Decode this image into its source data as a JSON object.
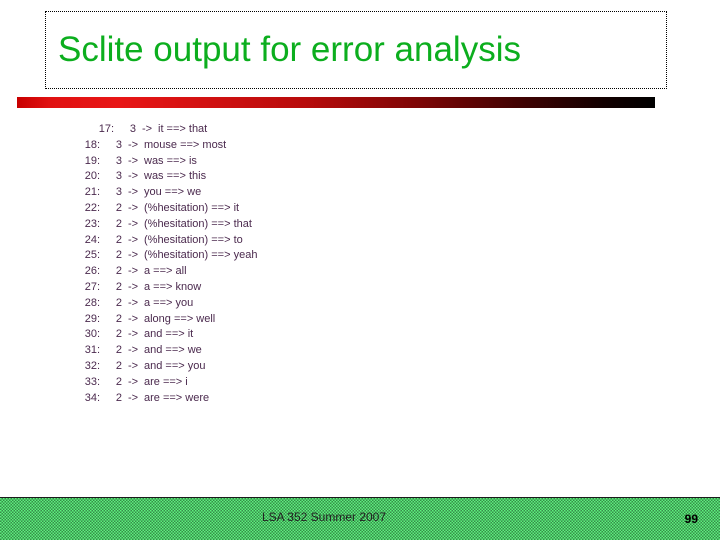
{
  "slide": {
    "title": "Sclite output for error analysis",
    "title_color": "#0CAE1E",
    "rule_color_start": "#e01111",
    "rule_color_end": "#000000"
  },
  "listing": {
    "rows": [
      {
        "index": "17:",
        "count": "3",
        "arrow": "->",
        "body": "it ==> that",
        "indented": true
      },
      {
        "index": "18:",
        "count": "3",
        "arrow": "->",
        "body": "mouse ==> most",
        "indented": false
      },
      {
        "index": "19:",
        "count": "3",
        "arrow": "->",
        "body": "was ==> is",
        "indented": false
      },
      {
        "index": "20:",
        "count": "3",
        "arrow": "->",
        "body": "was ==> this",
        "indented": false
      },
      {
        "index": "21:",
        "count": "3",
        "arrow": "->",
        "body": "you ==> we",
        "indented": false
      },
      {
        "index": "22:",
        "count": "2",
        "arrow": "->",
        "body": "(%hesitation) ==> it",
        "indented": false
      },
      {
        "index": "23:",
        "count": "2",
        "arrow": "->",
        "body": "(%hesitation) ==> that",
        "indented": false
      },
      {
        "index": "24:",
        "count": "2",
        "arrow": "->",
        "body": "(%hesitation) ==> to",
        "indented": false
      },
      {
        "index": "25:",
        "count": "2",
        "arrow": "->",
        "body": "(%hesitation) ==> yeah",
        "indented": false
      },
      {
        "index": "26:",
        "count": "2",
        "arrow": "->",
        "body": "a ==> all",
        "indented": false
      },
      {
        "index": "27:",
        "count": "2",
        "arrow": "->",
        "body": "a ==> know",
        "indented": false
      },
      {
        "index": "28:",
        "count": "2",
        "arrow": "->",
        "body": "a ==> you",
        "indented": false
      },
      {
        "index": "29:",
        "count": "2",
        "arrow": "->",
        "body": "along ==> well",
        "indented": false
      },
      {
        "index": "30:",
        "count": "2",
        "arrow": "->",
        "body": "and ==> it",
        "indented": false
      },
      {
        "index": "31:",
        "count": "2",
        "arrow": "->",
        "body": "and ==> we",
        "indented": false
      },
      {
        "index": "32:",
        "count": "2",
        "arrow": "->",
        "body": "and ==> you",
        "indented": false
      },
      {
        "index": "33:",
        "count": "2",
        "arrow": "->",
        "body": "are ==> i",
        "indented": false
      },
      {
        "index": "34:",
        "count": "2",
        "arrow": "->",
        "body": "are ==> were",
        "indented": false
      }
    ]
  },
  "footer": {
    "text": "LSA 352 Summer 2007",
    "page_number": "99",
    "band_color": "#5ef07e"
  }
}
